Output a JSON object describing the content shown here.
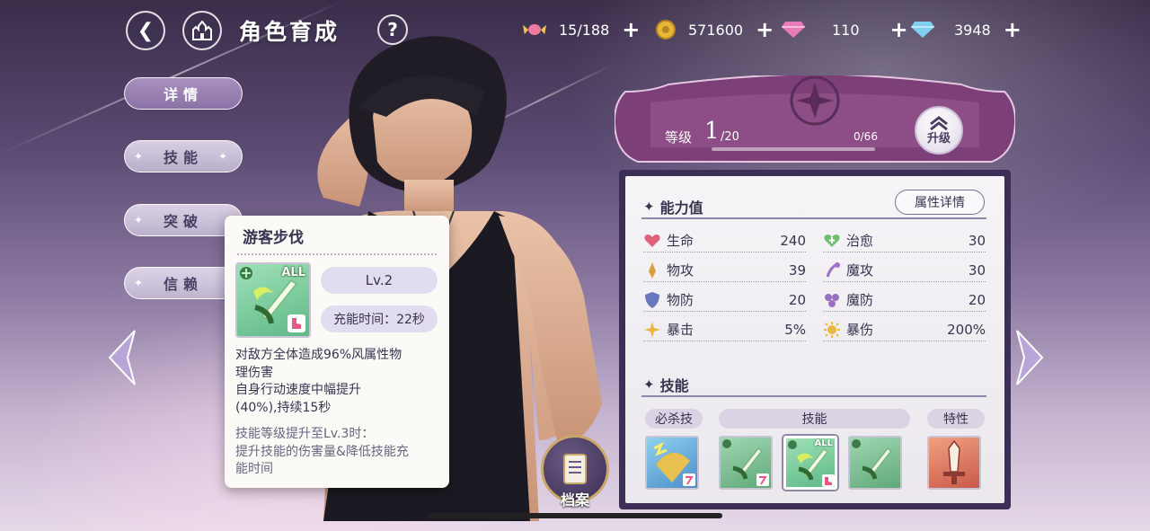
{
  "header": {
    "title": "角色育成",
    "back_icon": "back-arrow-icon",
    "home_icon": "castle-home-icon",
    "help_icon": "question-icon"
  },
  "resources": [
    {
      "name": "candy-icon",
      "value": "15/188"
    },
    {
      "name": "gold-coin-icon",
      "value": "571600"
    },
    {
      "name": "pink-diamond-icon",
      "value": "110"
    },
    {
      "name": "blue-diamond-icon",
      "value": "3948"
    }
  ],
  "side_tabs": [
    {
      "label": "详情",
      "active": true
    },
    {
      "label": "技能",
      "active": false
    },
    {
      "label": "突破",
      "active": false
    },
    {
      "label": "信赖",
      "active": false
    }
  ],
  "tooltip": {
    "title": "游客步伐",
    "badge": "ALL",
    "level": "Lv.2",
    "cooldown": "充能时间：22秒",
    "desc_lines": [
      "对敌方全体造成96%风属性物",
      "理伤害",
      "自身行动速度中幅提升",
      "(40%),持续15秒"
    ],
    "upgrade_lines": [
      "技能等级提升至Lv.3时：",
      "提升技能的伤害量&降低技能充",
      "能时间"
    ]
  },
  "archive": {
    "label": "档案"
  },
  "level": {
    "label": "等级",
    "value": "1",
    "max": "/20",
    "exp": "0/66",
    "exp_fraction": 0.0,
    "upgrade_label": "升级"
  },
  "stats_panel": {
    "title": "能力值",
    "detail_button": "属性详情",
    "stats": [
      {
        "name": "生命",
        "value": "240",
        "icon": "heart-icon",
        "color": "#e0607a"
      },
      {
        "name": "治愈",
        "value": "30",
        "icon": "heal-heart-icon",
        "color": "#6cc070"
      },
      {
        "name": "物攻",
        "value": "39",
        "icon": "physical-attack-icon",
        "color": "#d8a040"
      },
      {
        "name": "魔攻",
        "value": "30",
        "icon": "magic-attack-icon",
        "color": "#a070c8"
      },
      {
        "name": "物防",
        "value": "20",
        "icon": "physical-defense-icon",
        "color": "#6878c0"
      },
      {
        "name": "魔防",
        "value": "20",
        "icon": "magic-defense-icon",
        "color": "#9a70c0"
      },
      {
        "name": "暴击",
        "value": "5%",
        "icon": "crit-rate-icon",
        "color": "#e8b840"
      },
      {
        "name": "暴伤",
        "value": "200%",
        "icon": "crit-damage-icon",
        "color": "#e8b840"
      }
    ]
  },
  "skills_panel": {
    "title": "技能",
    "categories": [
      "必杀技",
      "技能",
      "特性"
    ],
    "skill_badge": "ALL"
  }
}
